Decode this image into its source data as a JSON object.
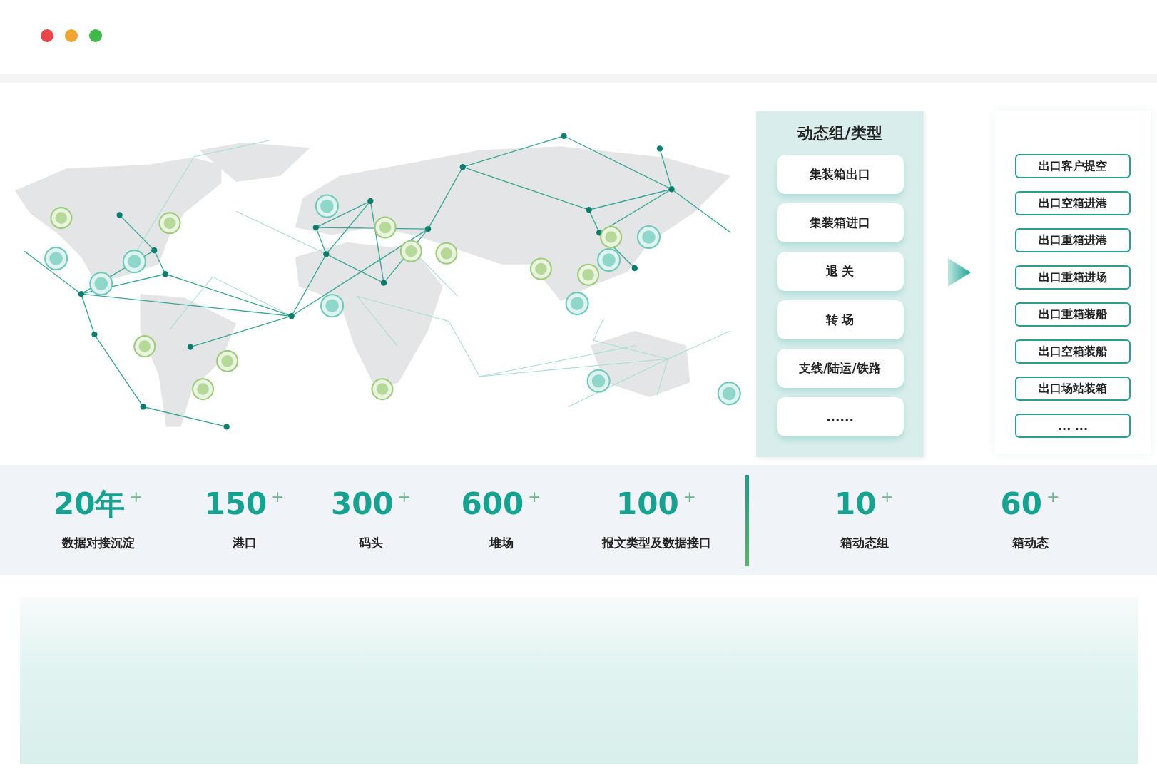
{
  "window": {
    "controls": [
      {
        "kind": "close"
      },
      {
        "kind": "minimize"
      },
      {
        "kind": "maximize"
      }
    ]
  },
  "group_panel": {
    "title": "动态组/类型",
    "items": [
      "集装箱出口",
      "集装箱进口",
      "退 关",
      "转 场",
      "支线/陆运/铁路",
      "......"
    ]
  },
  "event_panel": {
    "items": [
      "出口客户提空",
      "出口空箱进港",
      "出口重箱进港",
      "出口重箱进场",
      "出口重箱装船",
      "出口空箱装船",
      "出口场站装箱",
      "... ..."
    ]
  },
  "stats": [
    {
      "value": "20年",
      "plus": "+",
      "label": "数据对接沉淀"
    },
    {
      "value": "150",
      "plus": "+",
      "label": "港口"
    },
    {
      "value": "300",
      "plus": "+",
      "label": "码头"
    },
    {
      "value": "600",
      "plus": "+",
      "label": "堆场"
    },
    {
      "value": "100",
      "plus": "+",
      "label": "报文类型及数据接口"
    },
    {
      "value": "10",
      "plus": "+",
      "label": "箱动态组"
    },
    {
      "value": "60",
      "plus": "+",
      "label": "箱动态"
    }
  ]
}
